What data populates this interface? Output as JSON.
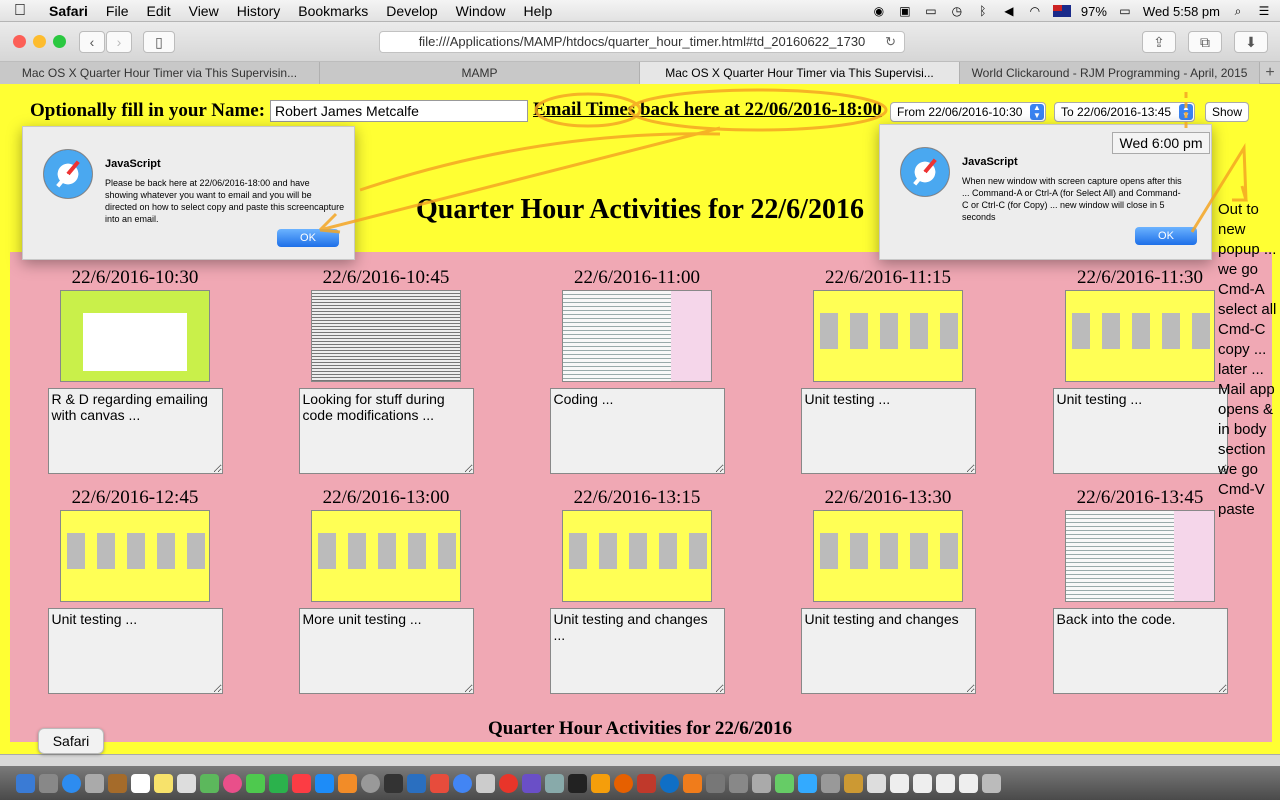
{
  "menubar": {
    "apple": "",
    "items": [
      "Safari",
      "File",
      "Edit",
      "View",
      "History",
      "Bookmarks",
      "Develop",
      "Window",
      "Help"
    ],
    "battery": "97%",
    "clock": "Wed 5:58 pm"
  },
  "toolbar": {
    "back": "‹",
    "forward": "›",
    "url": "file:///Applications/MAMP/htdocs/quarter_hour_timer.html#td_20160622_1730"
  },
  "tabs": [
    {
      "label": "Mac OS X Quarter Hour Timer via This Supervisin..."
    },
    {
      "label": "MAMP"
    },
    {
      "label": "Mac OS X Quarter Hour Timer via This Supervisi..."
    },
    {
      "label": "World Clickaround - RJM Programming - April, 2015"
    }
  ],
  "form": {
    "name_label": "Optionally fill in your Name:",
    "name_value": "Robert James Metcalfe",
    "email_link": "Email Times back here at 22/06/2016-18:00",
    "from_value": "From 22/06/2016-10:30",
    "to_value": "To 22/06/2016-13:45",
    "show_label": "Show"
  },
  "page_title": "Quarter Hour Activities for 22/6/2016",
  "bottom_title": "Quarter Hour Activities for 22/6/2016",
  "activities": [
    {
      "time": "22/6/2016-10:30",
      "note": "R & D regarding emailing with canvas ...",
      "thumb": "canvas"
    },
    {
      "time": "22/6/2016-10:45",
      "note": "Looking for stuff during code modifications ...",
      "thumb": "text"
    },
    {
      "time": "22/6/2016-11:00",
      "note": "Coding ...",
      "thumb": "code"
    },
    {
      "time": "22/6/2016-11:15",
      "note": "Unit testing ...",
      "thumb": "yellow"
    },
    {
      "time": "22/6/2016-11:30",
      "note": "Unit testing ...",
      "thumb": "yellow"
    },
    {
      "time": "22/6/2016-12:45",
      "note": "Unit testing ...",
      "thumb": "yellow"
    },
    {
      "time": "22/6/2016-13:00",
      "note": "More unit testing ...",
      "thumb": "yellow"
    },
    {
      "time": "22/6/2016-13:15",
      "note": "Unit testing and changes ...",
      "thumb": "yellow"
    },
    {
      "time": "22/6/2016-13:30",
      "note": "Unit testing and changes",
      "thumb": "yellow"
    },
    {
      "time": "22/6/2016-13:45",
      "note": "Back into the code.",
      "thumb": "code"
    }
  ],
  "dialog_left": {
    "title": "JavaScript",
    "text": "Please be back here at 22/06/2016-18:00 and have showing whatever you want to email and you will be directed on how to select copy and paste this screencapture into an email.",
    "ok": "OK"
  },
  "dialog_right": {
    "title": "JavaScript",
    "text": "When new window with screen capture opens after this ... Command-A or Ctrl-A (for Select All) and Command-C or Ctrl-C (for Copy) ... new window will close in 5 seconds",
    "ok": "OK"
  },
  "clock_box": "Wed 6:00 pm",
  "side_note": "Out to new popup ... we go Cmd-A select all Cmd-C copy ... later ... Mail app opens & in body section we go Cmd-V paste",
  "tooltip": "Safari",
  "colors": {
    "page_bg": "#ffff33",
    "pink": "#f0a8b4",
    "annotation": "#f5a623"
  }
}
